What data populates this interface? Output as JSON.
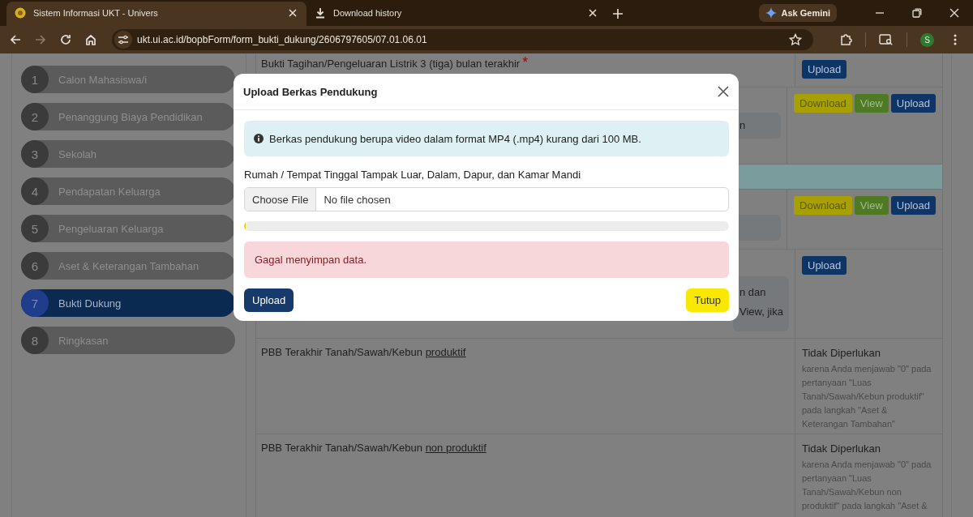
{
  "browser": {
    "tabs": [
      {
        "title": "Sistem Informasi UKT - Univers",
        "selected": true
      },
      {
        "title": "Download history",
        "selected": false
      }
    ],
    "gemini_button": "Ask Gemini",
    "url": "ukt.ui.ac.id/bopbForm/form_bukti_dukung/2606797605/07.01.06.01",
    "forward_disabled": true,
    "profile_initial": "S"
  },
  "sidebar": {
    "items": [
      {
        "number": "1",
        "label": "Calon Mahasiswa/i",
        "selected": false
      },
      {
        "number": "2",
        "label": "Penanggung Biaya Pendidikan",
        "selected": false
      },
      {
        "number": "3",
        "label": "Sekolah",
        "selected": false
      },
      {
        "number": "4",
        "label": "Pendapatan Keluarga",
        "selected": false
      },
      {
        "number": "5",
        "label": "Pengeluaran Keluarga",
        "selected": false
      },
      {
        "number": "6",
        "label": "Aset & Keterangan Tambahan",
        "selected": false
      },
      {
        "number": "7",
        "label": "Bukti Dukung",
        "selected": true
      },
      {
        "number": "8",
        "label": "Ringkasan",
        "selected": false
      }
    ]
  },
  "table": {
    "rows": [
      {
        "kind": "document",
        "title": "Bukti Tagihan/Pengeluaran Listrik 3 (tiga) bulan terakhir",
        "required_mark": "*",
        "actions": [
          "Upload"
        ]
      },
      {
        "kind": "document",
        "note_lines": [
          "n"
        ],
        "actions": [
          "Download",
          "View",
          "Upload"
        ]
      },
      {
        "kind": "section"
      },
      {
        "kind": "document",
        "note_lines": [],
        "actions": [
          "Download",
          "View",
          "Upload"
        ]
      },
      {
        "kind": "document",
        "note_lines": [
          "n dan",
          "View, jika"
        ],
        "actions": [
          "Upload"
        ]
      },
      {
        "kind": "not_needed",
        "title": "PBB Terakhir Tanah/Sawah/Kebun",
        "emphasis": "produktif",
        "status": "Tidak Diperlukan",
        "reason": "karena Anda menjawab \"0\" pada pertanyaan \"Luas Tanah/Sawah/Kebun produktif\" pada langkah \"Aset & Keterangan Tambahan\""
      },
      {
        "kind": "not_needed",
        "title": "PBB Terakhir Tanah/Sawah/Kebun",
        "emphasis": "non produktif",
        "status": "Tidak Diperlukan",
        "reason": "karena Anda menjawab \"0\" pada pertanyaan \"Luas Tanah/Sawah/Kebun non produktif\" pada langkah \"Aset &"
      }
    ]
  },
  "modal": {
    "title": "Upload Berkas Pendukung",
    "info": "Berkas pendukung berupa video dalam format MP4 (.mp4) kurang dari 100 MB.",
    "field_label": "Rumah / Tempat Tinggal Tampak Luar, Dalam, Dapur, dan Kamar Mandi",
    "file_button": "Choose File",
    "file_value": "No file chosen",
    "progress": {
      "level": 0.003
    },
    "error": "Gagal menyimpan data.",
    "upload_button": "Upload",
    "close_button": "Tutup"
  }
}
